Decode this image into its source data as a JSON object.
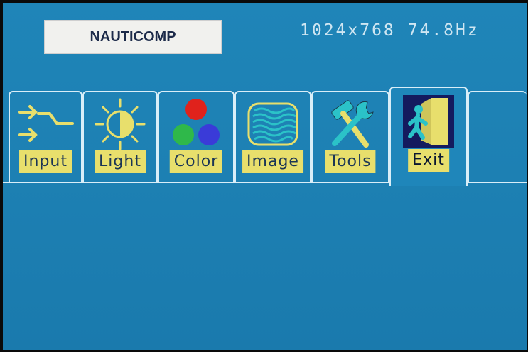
{
  "header": {
    "logo_text": "NAUTICOMP",
    "resolution": "1024x768 74.8Hz"
  },
  "tabs": [
    {
      "id": "input",
      "label": "Input",
      "icon": "input-arrows-icon"
    },
    {
      "id": "light",
      "label": "Light",
      "icon": "sun-brightness-icon"
    },
    {
      "id": "color",
      "label": "Color",
      "icon": "rgb-dots-icon"
    },
    {
      "id": "image",
      "label": "Image",
      "icon": "wave-image-icon"
    },
    {
      "id": "tools",
      "label": "Tools",
      "icon": "hammer-wrench-icon"
    },
    {
      "id": "exit",
      "label": "Exit",
      "icon": "door-exit-icon"
    }
  ],
  "active_tab": "exit",
  "colors": {
    "background": "#1d80b3",
    "label_bg": "#e8df6c",
    "tab_border": "#d9eef8"
  }
}
